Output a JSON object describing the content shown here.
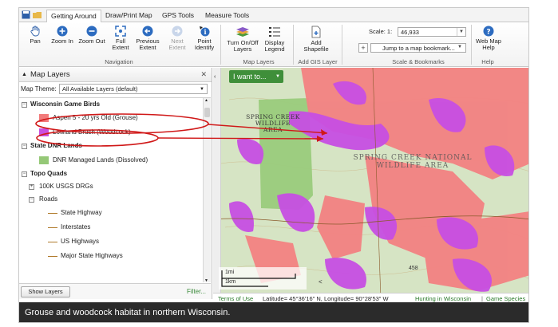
{
  "tabs": [
    {
      "label": "Getting Around",
      "active": true
    },
    {
      "label": "Draw/Print Map",
      "active": false
    },
    {
      "label": "GPS Tools",
      "active": false
    },
    {
      "label": "Measure Tools",
      "active": false
    }
  ],
  "ribbon": {
    "buttons": [
      {
        "label": "Pan",
        "icon": "hand-icon"
      },
      {
        "label": "Zoom In",
        "icon": "zoom-in-icon"
      },
      {
        "label": "Zoom Out",
        "icon": "zoom-out-icon"
      },
      {
        "label": "Full Extent",
        "icon": "full-extent-icon"
      },
      {
        "label": "Previous Extent",
        "icon": "previous-extent-icon"
      },
      {
        "label": "Next Extent",
        "icon": "next-extent-icon"
      },
      {
        "label": "Point Identify",
        "icon": "identify-icon"
      },
      {
        "label": "Turn On/Off Layers",
        "icon": "layers-icon"
      },
      {
        "label": "Display Legend",
        "icon": "legend-icon"
      },
      {
        "label": "Add Shapefile",
        "icon": "add-file-icon"
      },
      {
        "label": "Web Map Help",
        "icon": "help-icon"
      }
    ],
    "groups": {
      "navigation": "Navigation",
      "map_layers": "Map Layers",
      "add_gis": "Add GIS Layer",
      "scale_bookmarks": "Scale & Bookmarks",
      "help": "Help"
    },
    "scale_label": "Scale: 1:",
    "scale_value": "46,933",
    "bookmark_placeholder": "Jump to a map bookmark..."
  },
  "layers_panel": {
    "title": "Map Layers",
    "theme_label": "Map Theme:",
    "theme_value": "All Available Layers (default)",
    "show_layers": "Show Layers",
    "filter": "Filter...",
    "tree": {
      "game_birds": "Wisconsin Game Birds",
      "aspen": "Aspen 5 - 20 yrs Old (Grouse)",
      "lowland": "Lowland Brush (Woodcock)",
      "dnr_lands": "State DNR Lands",
      "dnr_managed": "DNR Managed Lands (Dissolved)",
      "topo": "Topo Quads",
      "usgs": "100K USGS DRGs",
      "roads": "Roads",
      "road_items": [
        "State Highway",
        "Interstates",
        "US Highways",
        "Major State Highways"
      ]
    }
  },
  "map": {
    "i_want_to": "I want to...",
    "label_area_1": "SPRING CREEK WILDLIFE AREA",
    "label_area_2": "SPRING CREEK NATIONAL WILDLIFE AREA",
    "scale_mi": "1mi",
    "scale_km": "1km",
    "spot_number": "458"
  },
  "status": {
    "terms": "Terms of Use",
    "coords": "Latitude= 45°36'16\" N, Longitude= 90°28'53\" W",
    "hunting": "Hunting in Wisconsin",
    "species": "Game Species"
  },
  "caption": "Grouse and woodcock habitat in northern Wisconsin.",
  "colors": {
    "aspen": "#f27b7b",
    "lowland": "#c94fe0",
    "dnr": "#95c877",
    "accent_green": "#3f8f3a",
    "annotation": "#d01818"
  }
}
